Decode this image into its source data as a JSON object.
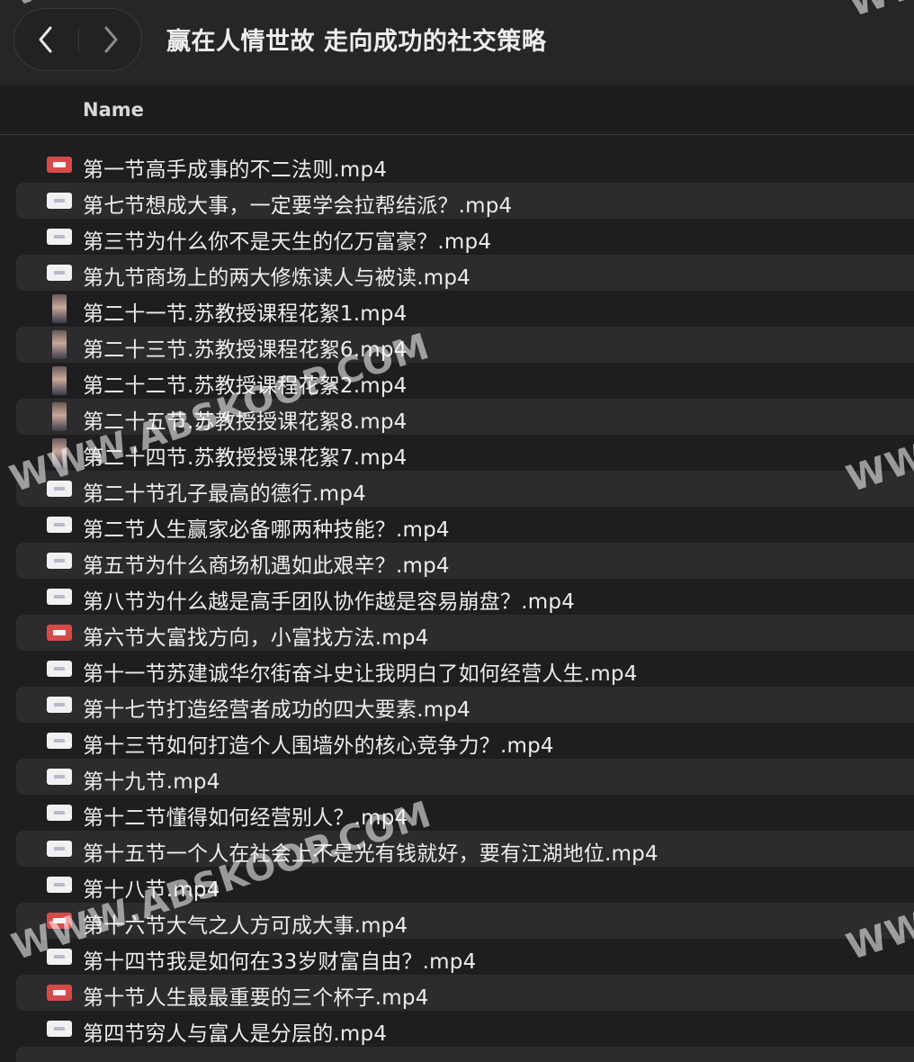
{
  "window": {
    "title": "赢在人情世故 走向成功的社交策略"
  },
  "nav": {
    "back_icon": "‹",
    "forward_icon": "›"
  },
  "table": {
    "column_name": "Name"
  },
  "files": [
    {
      "name": "第一节高手成事的不二法则.mp4",
      "thumb": "wide-red"
    },
    {
      "name": "第七节想成大事，一定要学会拉帮结派？.mp4",
      "thumb": "wide-white"
    },
    {
      "name": "第三节为什么你不是天生的亿万富豪？.mp4",
      "thumb": "wide-white"
    },
    {
      "name": "第九节商场上的两大修炼读人与被读.mp4",
      "thumb": "wide-white"
    },
    {
      "name": "第二十一节.苏教授课程花絮1.mp4",
      "thumb": "portrait"
    },
    {
      "name": "第二十三节.苏教授课程花絮6.mp4",
      "thumb": "portrait"
    },
    {
      "name": "第二十二节.苏教授课程花絮2.mp4",
      "thumb": "portrait"
    },
    {
      "name": "第二十五节.苏教授授课花絮8.mp4",
      "thumb": "portrait"
    },
    {
      "name": "第二十四节.苏教授授课花絮7.mp4",
      "thumb": "portrait"
    },
    {
      "name": "第二十节孔子最高的德行.mp4",
      "thumb": "wide-white"
    },
    {
      "name": "第二节人生赢家必备哪两种技能？.mp4",
      "thumb": "wide-white"
    },
    {
      "name": "第五节为什么商场机遇如此艰辛？.mp4",
      "thumb": "wide-white"
    },
    {
      "name": "第八节为什么越是高手团队协作越是容易崩盘？.mp4",
      "thumb": "wide-white"
    },
    {
      "name": "第六节大富找方向，小富找方法.mp4",
      "thumb": "wide-red"
    },
    {
      "name": "第十一节苏建诚华尔街奋斗史让我明白了如何经营人生.mp4",
      "thumb": "wide-white"
    },
    {
      "name": "第十七节打造经营者成功的四大要素.mp4",
      "thumb": "wide-white"
    },
    {
      "name": "第十三节如何打造个人围墙外的核心竞争力？.mp4",
      "thumb": "wide-white"
    },
    {
      "name": "第十九节.mp4",
      "thumb": "wide-white"
    },
    {
      "name": "第十二节懂得如何经营别人？.mp4",
      "thumb": "wide-white"
    },
    {
      "name": "第十五节一个人在社会上不是光有钱就好，要有江湖地位.mp4",
      "thumb": "wide-white"
    },
    {
      "name": "第十八节.mp4",
      "thumb": "wide-white"
    },
    {
      "name": "第十六节大气之人方可成大事.mp4",
      "thumb": "wide-red"
    },
    {
      "name": "第十四节我是如何在33岁财富自由？.mp4",
      "thumb": "wide-white"
    },
    {
      "name": "第十节人生最最重要的三个杯子.mp4",
      "thumb": "wide-red"
    },
    {
      "name": "第四节穷人与富人是分层的.mp4",
      "thumb": "wide-white"
    }
  ],
  "watermarks": [
    "WWW.",
    "WWW.",
    "WWW.ABSKOOP.COM",
    "WWW.",
    "WWW.ABSKOOP.COM",
    "WWW."
  ]
}
